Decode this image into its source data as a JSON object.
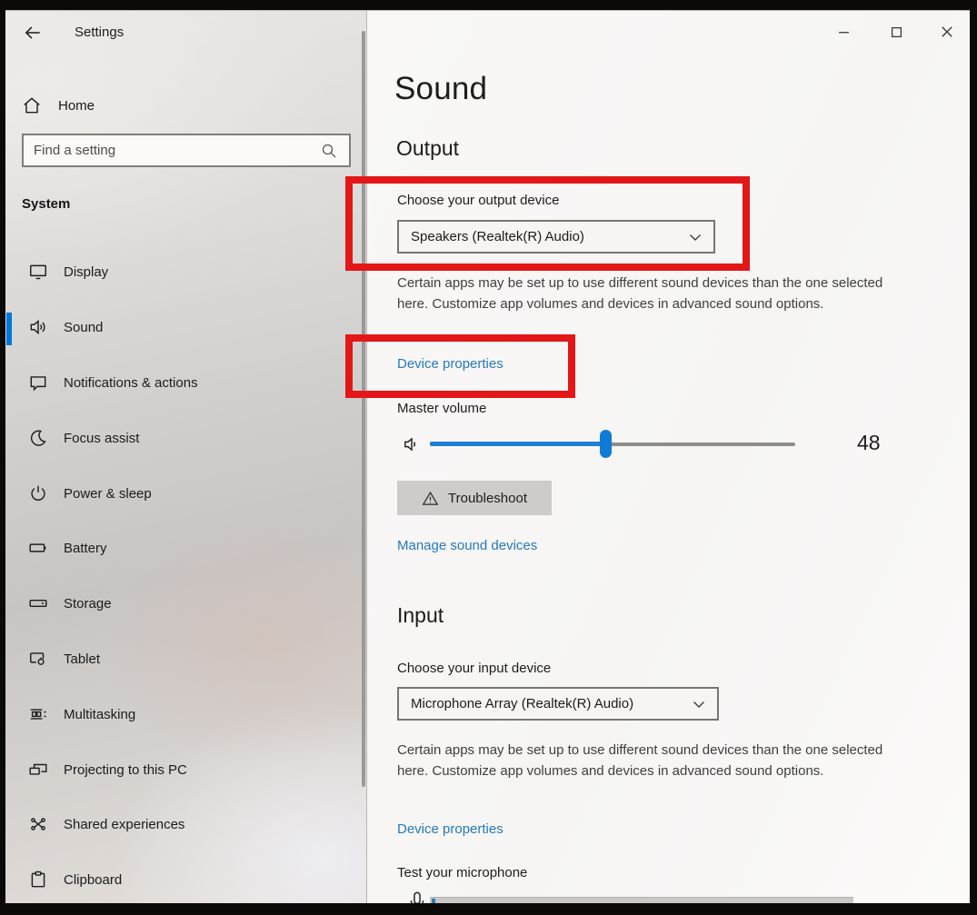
{
  "window": {
    "title": "Settings",
    "controls": {
      "minimize": "minimize",
      "maximize": "maximize",
      "close": "close"
    }
  },
  "sidebar": {
    "home_label": "Home",
    "search_placeholder": "Find a setting",
    "section_header": "System",
    "items": [
      {
        "label": "Display",
        "selected": false
      },
      {
        "label": "Sound",
        "selected": true
      },
      {
        "label": "Notifications & actions",
        "selected": false
      },
      {
        "label": "Focus assist",
        "selected": false
      },
      {
        "label": "Power & sleep",
        "selected": false
      },
      {
        "label": "Battery",
        "selected": false
      },
      {
        "label": "Storage",
        "selected": false
      },
      {
        "label": "Tablet",
        "selected": false
      },
      {
        "label": "Multitasking",
        "selected": false
      },
      {
        "label": "Projecting to this PC",
        "selected": false
      },
      {
        "label": "Shared experiences",
        "selected": false
      },
      {
        "label": "Clipboard",
        "selected": false
      }
    ]
  },
  "main": {
    "page_title": "Sound",
    "output": {
      "section_title": "Output",
      "choose_device_label": "Choose your output device",
      "selected_device": "Speakers (Realtek(R) Audio)",
      "description": "Certain apps may be set up to use different sound devices than the one selected here. Customize app volumes and devices in advanced sound options.",
      "device_properties_label": "Device properties",
      "master_volume_label": "Master volume",
      "master_volume_value": "48",
      "troubleshoot_label": "Troubleshoot",
      "manage_sound_devices_label": "Manage sound devices"
    },
    "input": {
      "section_title": "Input",
      "choose_device_label": "Choose your input device",
      "selected_device": "Microphone Array (Realtek(R) Audio)",
      "description": "Certain apps may be set up to use different sound devices than the one selected here. Customize app volumes and devices in advanced sound options.",
      "device_properties_label": "Device properties",
      "test_microphone_label": "Test your microphone"
    }
  },
  "slider": {
    "value": 48,
    "min": 0,
    "max": 100
  },
  "colors": {
    "accent": "#0078d7",
    "annotation_red": "#e31717",
    "link_blue": "#2579be",
    "slider_fill": "#1f7fd4",
    "troubleshoot_button_bg": "#cdcccb"
  }
}
